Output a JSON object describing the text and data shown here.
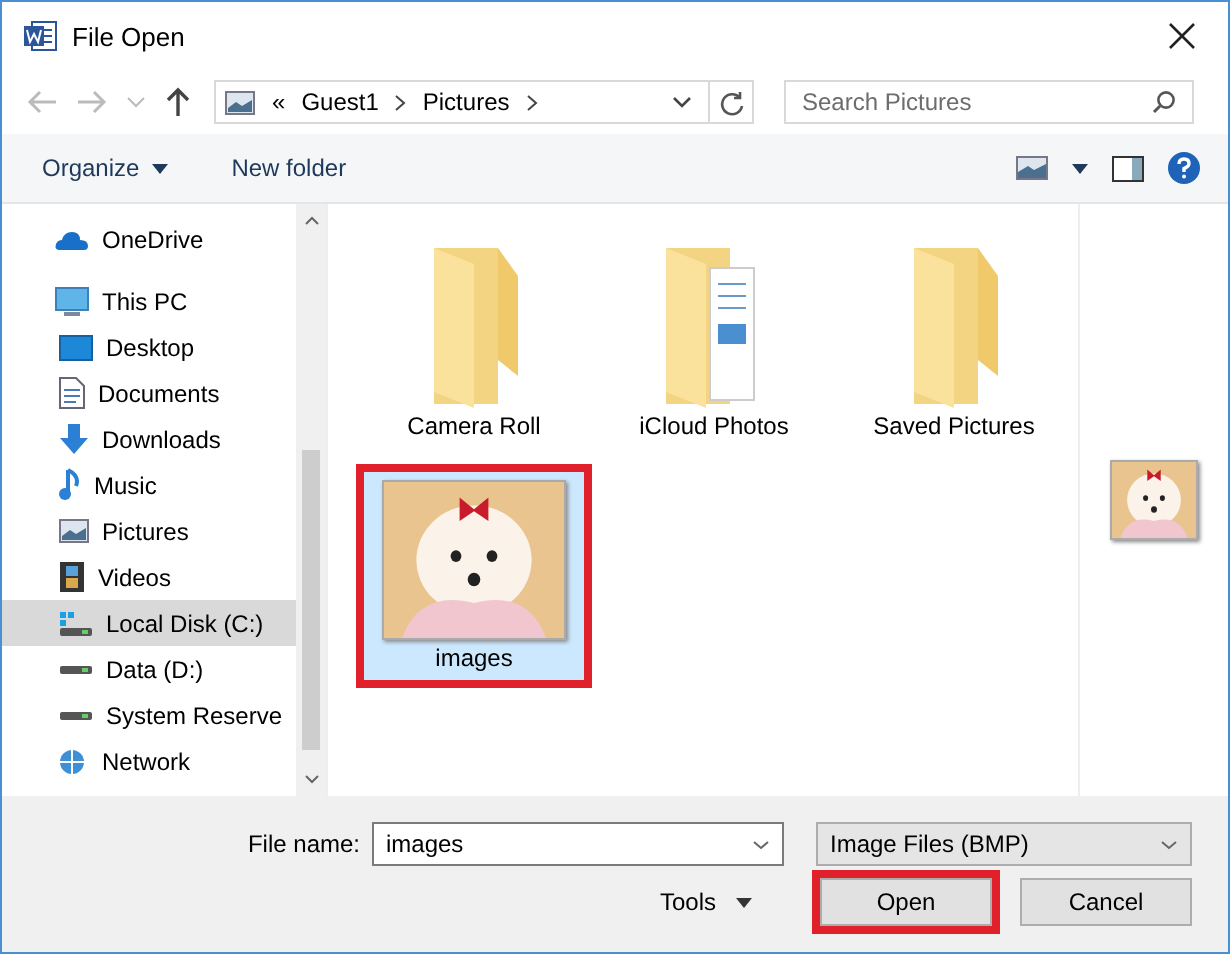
{
  "window": {
    "title": "File Open"
  },
  "address_bar": {
    "overflow": "«",
    "path": [
      "Guest1",
      "Pictures"
    ]
  },
  "search": {
    "placeholder": "Search Pictures"
  },
  "toolbar": {
    "organize": "Organize",
    "new_folder": "New folder"
  },
  "sidebar": {
    "items": [
      {
        "label": "OneDrive",
        "kind": "cloud",
        "selected": false
      },
      {
        "label": "This PC",
        "kind": "pc",
        "selected": false,
        "children": [
          {
            "label": "Desktop",
            "kind": "desktop",
            "selected": false
          },
          {
            "label": "Documents",
            "kind": "documents",
            "selected": false
          },
          {
            "label": "Downloads",
            "kind": "downloads",
            "selected": false
          },
          {
            "label": "Music",
            "kind": "music",
            "selected": false
          },
          {
            "label": "Pictures",
            "kind": "pictures",
            "selected": false
          },
          {
            "label": "Videos",
            "kind": "videos",
            "selected": false
          },
          {
            "label": "Local Disk (C:)",
            "kind": "system-disk",
            "selected": true
          },
          {
            "label": "Data (D:)",
            "kind": "disk",
            "selected": false
          },
          {
            "label": "System Reserve",
            "kind": "disk",
            "selected": false
          }
        ]
      },
      {
        "label": "Network",
        "kind": "network",
        "selected": false
      }
    ]
  },
  "files": [
    {
      "name": "Camera Roll",
      "kind": "folder",
      "selected": false,
      "highlighted": false
    },
    {
      "name": "iCloud Photos",
      "kind": "folder-documents",
      "selected": false,
      "highlighted": false
    },
    {
      "name": "Saved Pictures",
      "kind": "folder",
      "selected": false,
      "highlighted": false
    },
    {
      "name": "images",
      "kind": "photo",
      "selected": true,
      "highlighted": true
    }
  ],
  "preview": {
    "kind": "photo"
  },
  "footer": {
    "file_name_label": "File name:",
    "file_name": "images",
    "file_type": "Image Files (BMP)",
    "tools": "Tools",
    "buttons": [
      {
        "label": "Open",
        "highlighted": true
      },
      {
        "label": "Cancel",
        "highlighted": false
      }
    ]
  }
}
